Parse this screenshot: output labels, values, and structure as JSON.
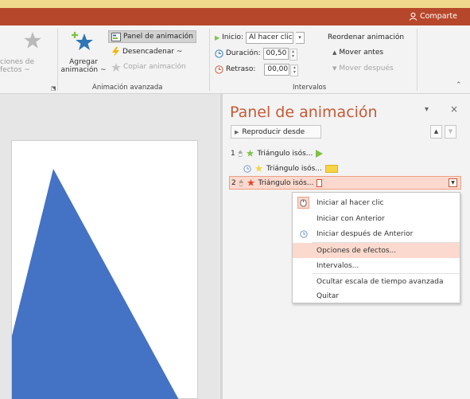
{
  "window": {
    "share_label": "Comparte"
  },
  "ribbon": {
    "opciones_efectos": {
      "line1": "ciones de",
      "line2": "fectos ~"
    },
    "agregar": {
      "line1": "Agregar",
      "line2": "animación ~"
    },
    "panel_btn": "Panel de animación",
    "desencadenar": "Desencadenar ~",
    "copiar": "Copiar animación",
    "group_avanzada": "Animación avanzada",
    "inicio_label": "Inicio:",
    "inicio_value": "Al hacer clic",
    "duracion_label": "Duración:",
    "duracion_value": "00,50",
    "retraso_label": "Retraso:",
    "retraso_value": "00,00",
    "reordenar": "Reordenar animación",
    "mover_antes": "Mover antes",
    "mover_despues": "Mover después",
    "group_intervalos": "Intervalos"
  },
  "pane": {
    "title": "Panel de animación",
    "play_label": "Reproducir desde",
    "items": [
      {
        "num": "1",
        "label": "Triángulo isós..."
      },
      {
        "num": "",
        "label": "Triángulo isós..."
      },
      {
        "num": "2",
        "label": "Triángulo isós..."
      }
    ]
  },
  "menu": {
    "items": [
      "Iniciar al hacer clic",
      "Iniciar con Anterior",
      "Iniciar después de Anterior",
      "Opciones de efectos...",
      "Intervalos...",
      "Ocultar escala de tiempo avanzada",
      "Quitar"
    ]
  },
  "colors": {
    "accent": "#b7472a",
    "title_orange": "#c55a36",
    "selection": "#fbd9ce",
    "triangle": "#4472c4",
    "entrance_green": "#7dc243",
    "emphasis_yellow": "#f7d443",
    "exit_red": "#e0492c"
  }
}
